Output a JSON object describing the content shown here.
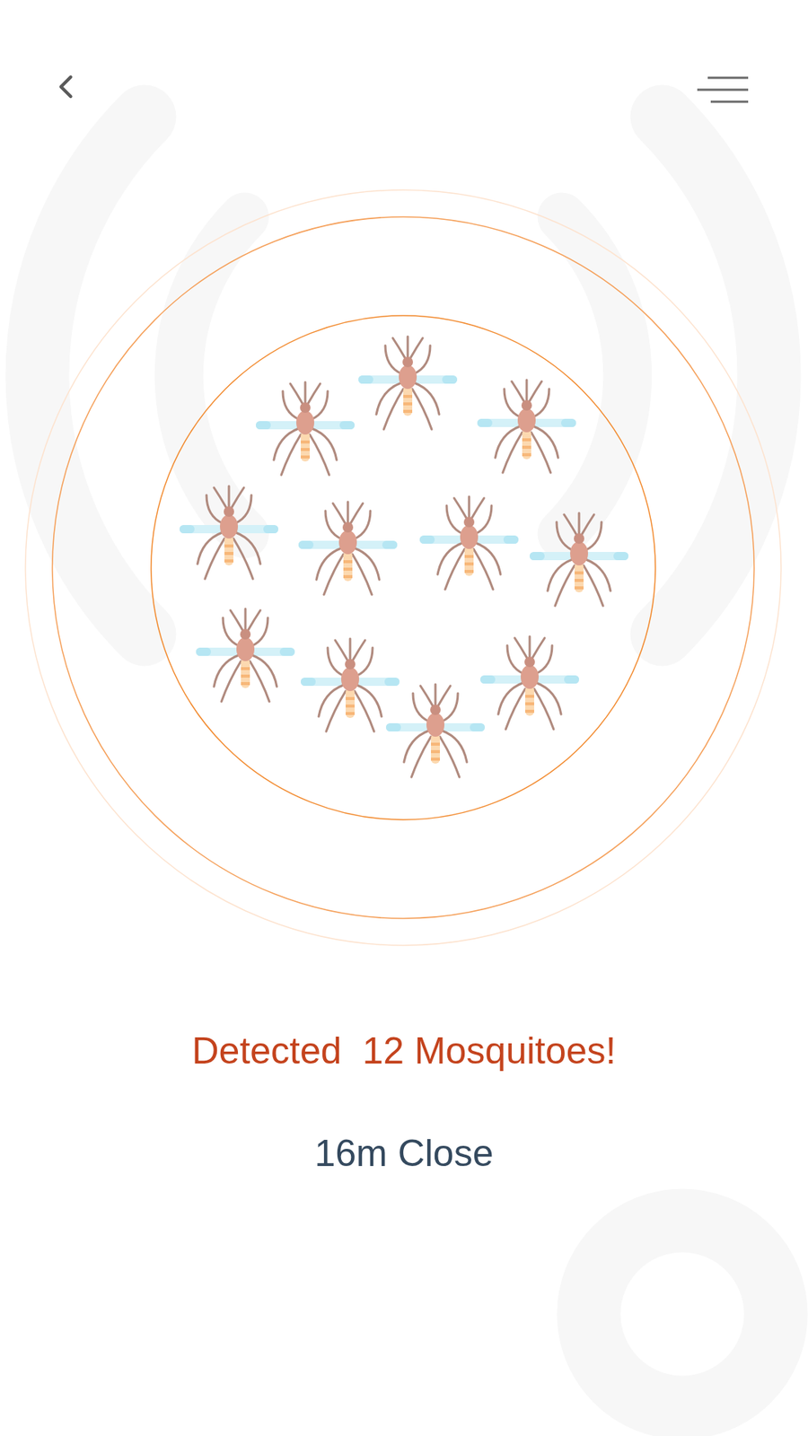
{
  "detection": {
    "title": "Detected  12 Mosquitoes!",
    "distance": "16m Close"
  }
}
